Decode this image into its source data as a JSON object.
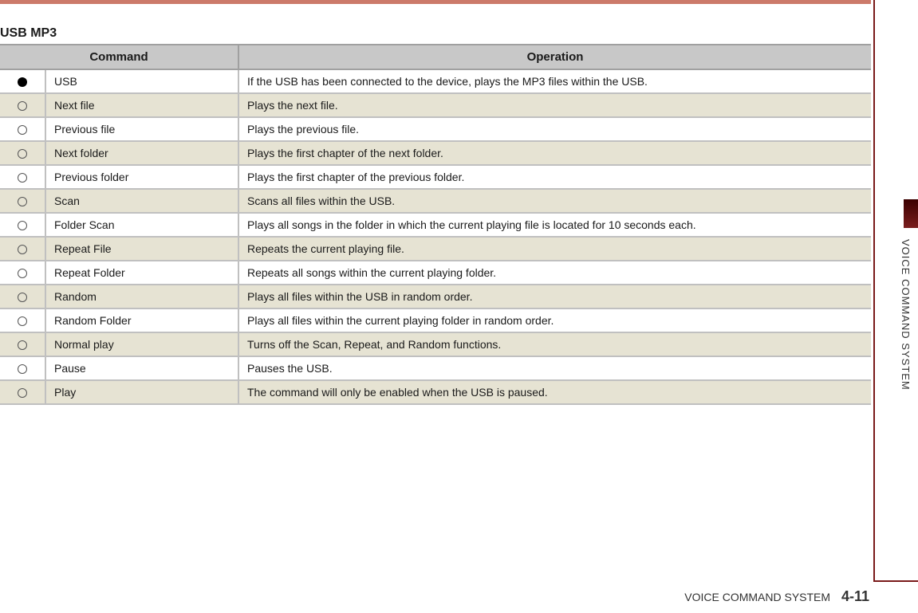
{
  "section_title": "USB MP3",
  "table": {
    "headers": {
      "command": "Command",
      "operation": "Operation"
    },
    "rows": [
      {
        "sym": "filled",
        "cmd": "USB",
        "op": "If the USB has been connected to the device, plays the MP3 files within the USB."
      },
      {
        "sym": "hollow",
        "cmd": "Next file",
        "op": "Plays the next file."
      },
      {
        "sym": "hollow",
        "cmd": "Previous file",
        "op": "Plays the previous file."
      },
      {
        "sym": "hollow",
        "cmd": "Next folder",
        "op": "Plays the first chapter of the next folder."
      },
      {
        "sym": "hollow",
        "cmd": "Previous folder",
        "op": "Plays the first chapter of the previous folder."
      },
      {
        "sym": "hollow",
        "cmd": "Scan",
        "op": "Scans all files within the USB."
      },
      {
        "sym": "hollow",
        "cmd": "Folder Scan",
        "op": "Plays all songs in the folder in which the current playing file is located for 10 seconds each."
      },
      {
        "sym": "hollow",
        "cmd": "Repeat File",
        "op": "Repeats the current playing file."
      },
      {
        "sym": "hollow",
        "cmd": "Repeat Folder",
        "op": "Repeats all songs within the current playing folder."
      },
      {
        "sym": "hollow",
        "cmd": "Random",
        "op": "Plays all files within the USB in random order."
      },
      {
        "sym": "hollow",
        "cmd": "Random Folder",
        "op": "Plays all files within the current playing folder in random order."
      },
      {
        "sym": "hollow",
        "cmd": "Normal play",
        "op": "Turns off the Scan, Repeat, and Random functions."
      },
      {
        "sym": "hollow",
        "cmd": "Pause",
        "op": "Pauses the USB."
      },
      {
        "sym": "hollow",
        "cmd": "Play",
        "op": "The command will only be enabled when the USB is paused."
      }
    ]
  },
  "side_tab_label": "VOICE COMMAND SYSTEM",
  "footer": {
    "label": "VOICE COMMAND SYSTEM",
    "page": "4-11"
  }
}
